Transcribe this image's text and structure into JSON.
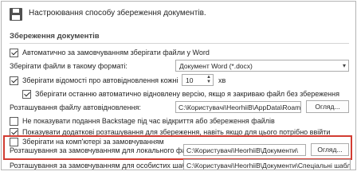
{
  "header": {
    "title": "Настроювання способу збереження документів."
  },
  "section": {
    "title": "Збереження документів"
  },
  "autosave_cb": {
    "label": "Автоматично за замовчуванням зберігати файли у Word",
    "checked": true
  },
  "format": {
    "label": "Зберігати файли в такому форматі:",
    "value": "Документ Word (*.docx)"
  },
  "autorecover": {
    "label": "Зберігати відомості про автовідновлення кожні",
    "checked": true,
    "value": "10",
    "unit": "хв"
  },
  "keep_last": {
    "label": "Зберігати останню автоматично відновлену версію, якщо я закриваю файл без збереження",
    "checked": true
  },
  "autorecover_location": {
    "label": "Розташування файлу автовідновлення:",
    "value": "C:\\Користувачі\\HeorhiiB\\AppData\\Roaming",
    "button": "Огляд..."
  },
  "no_backstage": {
    "label": "Не показувати подання Backstage під час відкриття або збереження файлів",
    "checked": false
  },
  "show_additional": {
    "label": "Показувати додаткові розташування для збереження, навіть якщо для цього потрібно ввійти",
    "checked": true
  },
  "save_to_computer": {
    "label": "Зберігати на комп'ютері за замовчуванням",
    "checked": false
  },
  "local_location": {
    "label": "Розташування за замовчуванням для локального файлу:",
    "value": "C:\\Користувачі\\HeorhiiB\\Документи\\",
    "button": "Огляд..."
  },
  "templates_location": {
    "label": "Розташування за замовчуванням для особистих шаблонів:",
    "value": "C:\\Користувачі\\HeorhiiB\\Документи\\Спеціальні шаблони"
  }
}
